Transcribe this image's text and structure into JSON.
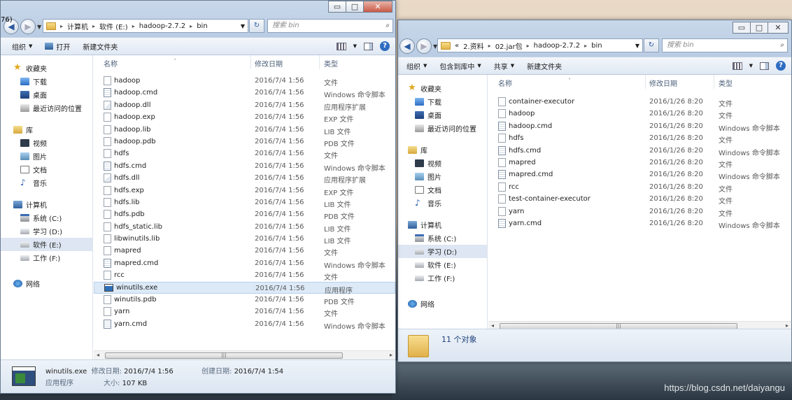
{
  "left_window": {
    "title_fragment": "76)",
    "caption_buttons": [
      "▭",
      "□",
      "✕"
    ],
    "breadcrumb": [
      "计算机",
      "软件 (E:)",
      "hadoop-2.7.2",
      "bin"
    ],
    "search_placeholder": "搜索 bin",
    "toolbar": {
      "organize": "组织",
      "open": "打开",
      "new_folder": "新建文件夹"
    },
    "columns": {
      "name": "名称",
      "date": "修改日期",
      "type": "类型"
    },
    "nav": {
      "favorites": "收藏夹",
      "downloads": "下载",
      "desktop": "桌面",
      "recent": "最近访问的位置",
      "libraries": "库",
      "videos": "视频",
      "pictures": "图片",
      "documents": "文档",
      "music": "音乐",
      "computer": "计算机",
      "drive_c": "系统 (C:)",
      "drive_d": "学习 (D:)",
      "drive_e": "软件 (E:)",
      "drive_f": "工作 (F:)",
      "network": "网络"
    },
    "files": [
      {
        "name": "hadoop",
        "date": "2016/7/4 1:56",
        "type": "文件",
        "icon": "file"
      },
      {
        "name": "hadoop.cmd",
        "date": "2016/7/4 1:56",
        "type": "Windows 命令脚本",
        "icon": "cmd"
      },
      {
        "name": "hadoop.dll",
        "date": "2016/7/4 1:56",
        "type": "应用程序扩展",
        "icon": "dll"
      },
      {
        "name": "hadoop.exp",
        "date": "2016/7/4 1:56",
        "type": "EXP 文件",
        "icon": "file"
      },
      {
        "name": "hadoop.lib",
        "date": "2016/7/4 1:56",
        "type": "LIB 文件",
        "icon": "file"
      },
      {
        "name": "hadoop.pdb",
        "date": "2016/7/4 1:56",
        "type": "PDB 文件",
        "icon": "file"
      },
      {
        "name": "hdfs",
        "date": "2016/7/4 1:56",
        "type": "文件",
        "icon": "file"
      },
      {
        "name": "hdfs.cmd",
        "date": "2016/7/4 1:56",
        "type": "Windows 命令脚本",
        "icon": "cmd"
      },
      {
        "name": "hdfs.dll",
        "date": "2016/7/4 1:56",
        "type": "应用程序扩展",
        "icon": "dll"
      },
      {
        "name": "hdfs.exp",
        "date": "2016/7/4 1:56",
        "type": "EXP 文件",
        "icon": "file"
      },
      {
        "name": "hdfs.lib",
        "date": "2016/7/4 1:56",
        "type": "LIB 文件",
        "icon": "file"
      },
      {
        "name": "hdfs.pdb",
        "date": "2016/7/4 1:56",
        "type": "PDB 文件",
        "icon": "file"
      },
      {
        "name": "hdfs_static.lib",
        "date": "2016/7/4 1:56",
        "type": "LIB 文件",
        "icon": "file"
      },
      {
        "name": "libwinutils.lib",
        "date": "2016/7/4 1:56",
        "type": "LIB 文件",
        "icon": "file"
      },
      {
        "name": "mapred",
        "date": "2016/7/4 1:56",
        "type": "文件",
        "icon": "file"
      },
      {
        "name": "mapred.cmd",
        "date": "2016/7/4 1:56",
        "type": "Windows 命令脚本",
        "icon": "cmd"
      },
      {
        "name": "rcc",
        "date": "2016/7/4 1:56",
        "type": "文件",
        "icon": "file"
      },
      {
        "name": "winutils.exe",
        "date": "2016/7/4 1:56",
        "type": "应用程序",
        "icon": "exe",
        "selected": true
      },
      {
        "name": "winutils.pdb",
        "date": "2016/7/4 1:56",
        "type": "PDB 文件",
        "icon": "file"
      },
      {
        "name": "yarn",
        "date": "2016/7/4 1:56",
        "type": "文件",
        "icon": "file"
      },
      {
        "name": "yarn.cmd",
        "date": "2016/7/4 1:56",
        "type": "Windows 命令脚本",
        "icon": "cmd"
      }
    ],
    "details": {
      "name": "winutils.exe",
      "modified_label": "修改日期:",
      "modified_value": "2016/7/4 1:56",
      "created_label": "创建日期:",
      "created_value": "2016/7/4 1:54",
      "type": "应用程序",
      "size_label": "大小:",
      "size_value": "107 KB"
    }
  },
  "right_window": {
    "caption_buttons": [
      "▭",
      "□",
      "✕"
    ],
    "breadcrumb": [
      "«",
      "2.资料",
      "02.jar包",
      "hadoop-2.7.2",
      "bin"
    ],
    "search_placeholder": "搜索 bin",
    "toolbar": {
      "organize": "组织",
      "include_library": "包含到库中",
      "share": "共享",
      "new_folder": "新建文件夹"
    },
    "columns": {
      "name": "名称",
      "date": "修改日期",
      "type": "类型"
    },
    "nav": {
      "favorites": "收藏夹",
      "downloads": "下载",
      "desktop": "桌面",
      "recent": "最近访问的位置",
      "libraries": "库",
      "videos": "视频",
      "pictures": "图片",
      "documents": "文档",
      "music": "音乐",
      "computer": "计算机",
      "drive_c": "系统 (C:)",
      "drive_d": "学习 (D:)",
      "drive_e": "软件 (E:)",
      "drive_f": "工作 (F:)",
      "network": "网络"
    },
    "files": [
      {
        "name": "container-executor",
        "date": "2016/1/26 8:20",
        "type": "文件",
        "icon": "file"
      },
      {
        "name": "hadoop",
        "date": "2016/1/26 8:20",
        "type": "文件",
        "icon": "file"
      },
      {
        "name": "hadoop.cmd",
        "date": "2016/1/26 8:20",
        "type": "Windows 命令脚本",
        "icon": "cmd"
      },
      {
        "name": "hdfs",
        "date": "2016/1/26 8:20",
        "type": "文件",
        "icon": "file"
      },
      {
        "name": "hdfs.cmd",
        "date": "2016/1/26 8:20",
        "type": "Windows 命令脚本",
        "icon": "cmd"
      },
      {
        "name": "mapred",
        "date": "2016/1/26 8:20",
        "type": "文件",
        "icon": "file"
      },
      {
        "name": "mapred.cmd",
        "date": "2016/1/26 8:20",
        "type": "Windows 命令脚本",
        "icon": "cmd"
      },
      {
        "name": "rcc",
        "date": "2016/1/26 8:20",
        "type": "文件",
        "icon": "file"
      },
      {
        "name": "test-container-executor",
        "date": "2016/1/26 8:20",
        "type": "文件",
        "icon": "file"
      },
      {
        "name": "yarn",
        "date": "2016/1/26 8:20",
        "type": "文件",
        "icon": "file"
      },
      {
        "name": "yarn.cmd",
        "date": "2016/1/26 8:20",
        "type": "Windows 命令脚本",
        "icon": "cmd"
      }
    ],
    "status": "11 个对象"
  },
  "watermark": "https://blog.csdn.net/daiyangu"
}
